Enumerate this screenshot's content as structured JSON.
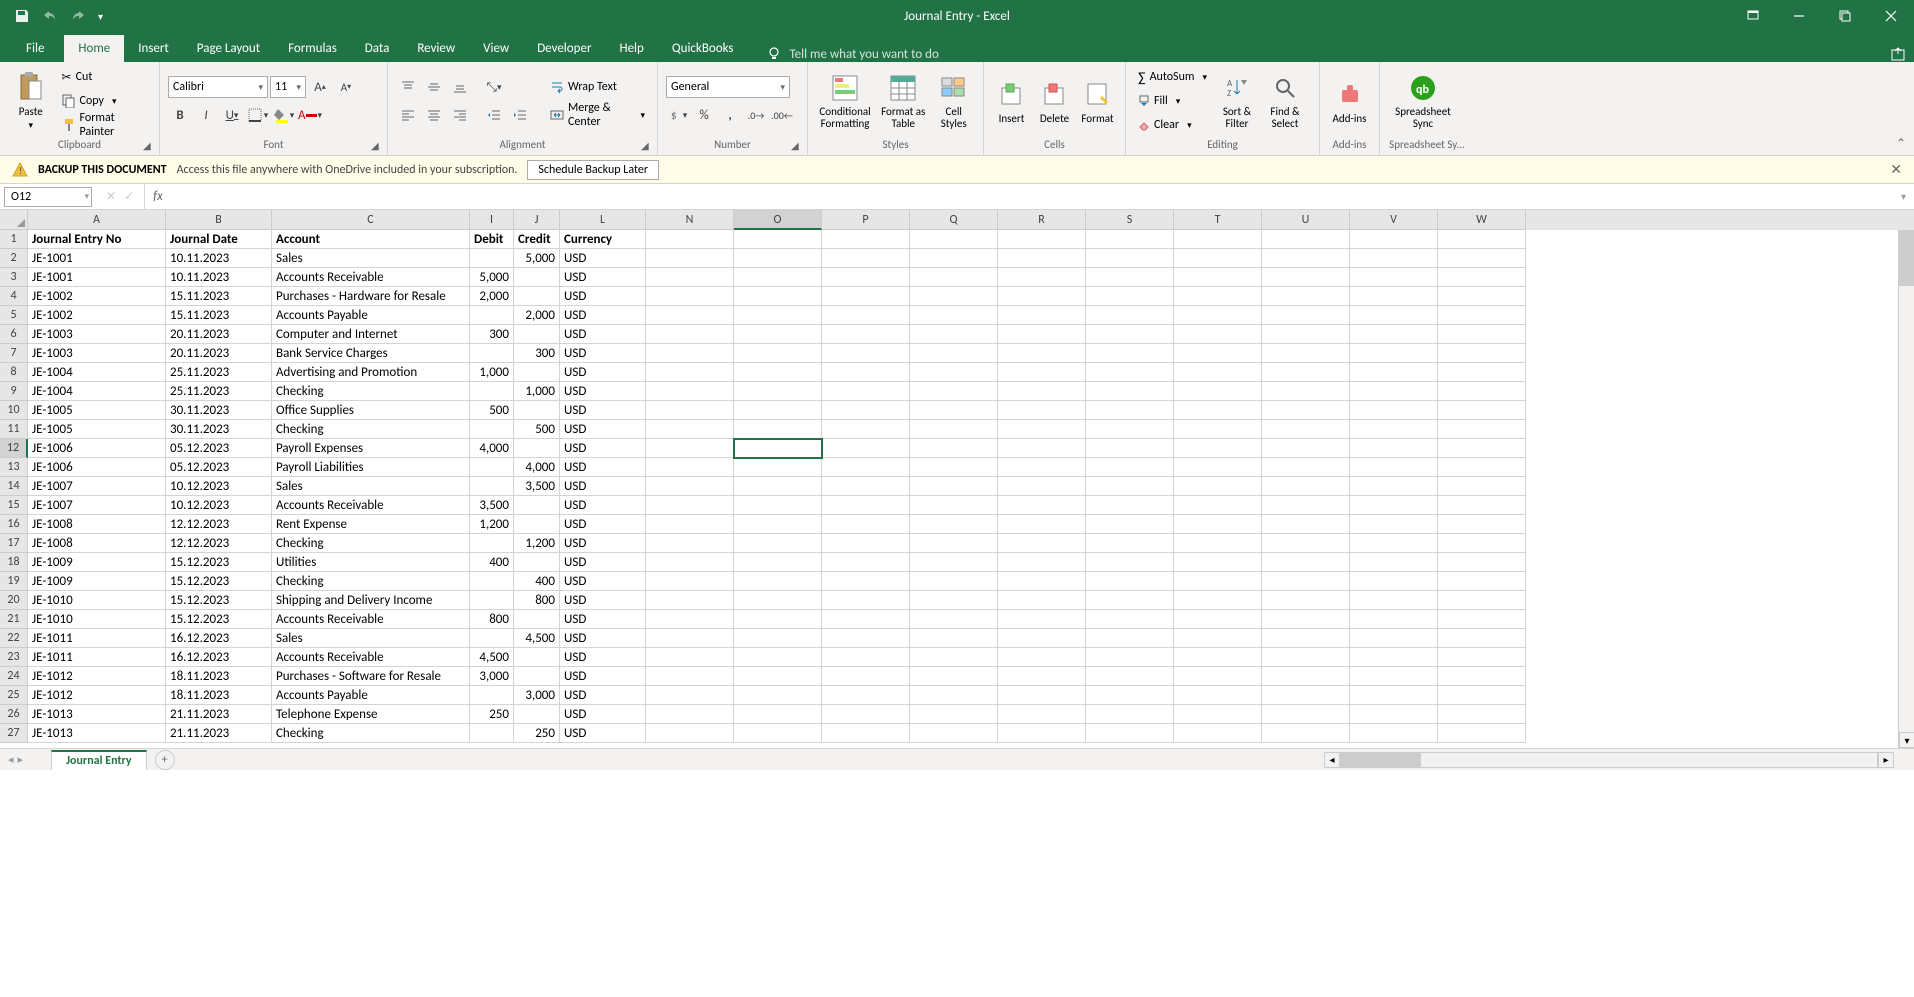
{
  "title": "Journal Entry  -  Excel",
  "ribbon_tabs": [
    "File",
    "Home",
    "Insert",
    "Page Layout",
    "Formulas",
    "Data",
    "Review",
    "View",
    "Developer",
    "Help",
    "QuickBooks"
  ],
  "active_tab": "Home",
  "tell_me": "Tell me what you want to do",
  "clipboard": {
    "paste": "Paste",
    "cut": "Cut",
    "copy": "Copy",
    "format_painter": "Format Painter",
    "label": "Clipboard"
  },
  "font": {
    "name": "Calibri",
    "size": "11",
    "label": "Font"
  },
  "alignment": {
    "wrap": "Wrap Text",
    "merge": "Merge & Center",
    "label": "Alignment"
  },
  "number": {
    "format": "General",
    "label": "Number"
  },
  "styles": {
    "conditional": "Conditional Formatting",
    "table": "Format as Table",
    "cell": "Cell Styles",
    "label": "Styles"
  },
  "cells": {
    "insert": "Insert",
    "delete": "Delete",
    "format": "Format",
    "label": "Cells"
  },
  "editing": {
    "autosum": "AutoSum",
    "fill": "Fill",
    "clear": "Clear",
    "sort": "Sort & Filter",
    "find": "Find & Select",
    "label": "Editing"
  },
  "addins": {
    "btn": "Add-ins",
    "label": "Add-ins"
  },
  "qb": {
    "sync": "Spreadsheet Sync",
    "label": "Spreadsheet Sy..."
  },
  "message_bar": {
    "strong": "BACKUP THIS DOCUMENT",
    "text": "Access this file anywhere with OneDrive included in your subscription.",
    "btn": "Schedule Backup Later"
  },
  "name_box": "O12",
  "formula_value": "",
  "sheet_tab": "Journal Entry",
  "columns": [
    "A",
    "B",
    "C",
    "I",
    "J",
    "L",
    "N",
    "O",
    "P",
    "Q",
    "R",
    "S",
    "T",
    "U",
    "V",
    "W"
  ],
  "col_widths": {
    "A": 138,
    "B": 106,
    "C": 198,
    "I": 44,
    "J": 46,
    "L": 86,
    "N": 88,
    "O": 88,
    "P": 88,
    "Q": 88,
    "R": 88,
    "S": 88,
    "T": 88,
    "U": 88,
    "V": 88,
    "W": 88
  },
  "selected_cell": {
    "row": 12,
    "col": "O"
  },
  "headers": {
    "A": "Journal Entry No",
    "B": "Journal Date",
    "C": "Account",
    "I": "Debit",
    "J": "Credit",
    "L": "Currency"
  },
  "rows": [
    {
      "n": 2,
      "A": "JE-1001",
      "B": "10.11.2023",
      "C": "Sales",
      "I": "",
      "J": "5,000",
      "L": "USD"
    },
    {
      "n": 3,
      "A": "JE-1001",
      "B": "10.11.2023",
      "C": "Accounts Receivable",
      "I": "5,000",
      "J": "",
      "L": "USD"
    },
    {
      "n": 4,
      "A": "JE-1002",
      "B": "15.11.2023",
      "C": "Purchases - Hardware for Resale",
      "I": "2,000",
      "J": "",
      "L": "USD"
    },
    {
      "n": 5,
      "A": "JE-1002",
      "B": "15.11.2023",
      "C": "Accounts Payable",
      "I": "",
      "J": "2,000",
      "L": "USD"
    },
    {
      "n": 6,
      "A": "JE-1003",
      "B": "20.11.2023",
      "C": "Computer and Internet",
      "I": "300",
      "J": "",
      "L": "USD"
    },
    {
      "n": 7,
      "A": "JE-1003",
      "B": "20.11.2023",
      "C": "Bank Service Charges",
      "I": "",
      "J": "300",
      "L": "USD"
    },
    {
      "n": 8,
      "A": "JE-1004",
      "B": "25.11.2023",
      "C": "Advertising and Promotion",
      "I": "1,000",
      "J": "",
      "L": "USD"
    },
    {
      "n": 9,
      "A": "JE-1004",
      "B": "25.11.2023",
      "C": "Checking",
      "I": "",
      "J": "1,000",
      "L": "USD"
    },
    {
      "n": 10,
      "A": "JE-1005",
      "B": "30.11.2023",
      "C": "Office Supplies",
      "I": "500",
      "J": "",
      "L": "USD"
    },
    {
      "n": 11,
      "A": "JE-1005",
      "B": "30.11.2023",
      "C": "Checking",
      "I": "",
      "J": "500",
      "L": "USD"
    },
    {
      "n": 12,
      "A": "JE-1006",
      "B": "05.12.2023",
      "C": "Payroll Expenses",
      "I": "4,000",
      "J": "",
      "L": "USD"
    },
    {
      "n": 13,
      "A": "JE-1006",
      "B": "05.12.2023",
      "C": "Payroll Liabilities",
      "I": "",
      "J": "4,000",
      "L": "USD"
    },
    {
      "n": 14,
      "A": "JE-1007",
      "B": "10.12.2023",
      "C": "Sales",
      "I": "",
      "J": "3,500",
      "L": "USD"
    },
    {
      "n": 15,
      "A": "JE-1007",
      "B": "10.12.2023",
      "C": "Accounts Receivable",
      "I": "3,500",
      "J": "",
      "L": "USD"
    },
    {
      "n": 16,
      "A": "JE-1008",
      "B": "12.12.2023",
      "C": "Rent Expense",
      "I": "1,200",
      "J": "",
      "L": "USD"
    },
    {
      "n": 17,
      "A": "JE-1008",
      "B": "12.12.2023",
      "C": "Checking",
      "I": "",
      "J": "1,200",
      "L": "USD"
    },
    {
      "n": 18,
      "A": "JE-1009",
      "B": "15.12.2023",
      "C": "Utilities",
      "I": "400",
      "J": "",
      "L": "USD"
    },
    {
      "n": 19,
      "A": "JE-1009",
      "B": "15.12.2023",
      "C": "Checking",
      "I": "",
      "J": "400",
      "L": "USD"
    },
    {
      "n": 20,
      "A": "JE-1010",
      "B": "15.12.2023",
      "C": "Shipping and Delivery Income",
      "I": "",
      "J": "800",
      "L": "USD"
    },
    {
      "n": 21,
      "A": "JE-1010",
      "B": "15.12.2023",
      "C": "Accounts Receivable",
      "I": "800",
      "J": "",
      "L": "USD"
    },
    {
      "n": 22,
      "A": "JE-1011",
      "B": "16.12.2023",
      "C": "Sales",
      "I": "",
      "J": "4,500",
      "L": "USD"
    },
    {
      "n": 23,
      "A": "JE-1011",
      "B": "16.12.2023",
      "C": "Accounts Receivable",
      "I": "4,500",
      "J": "",
      "L": "USD"
    },
    {
      "n": 24,
      "A": "JE-1012",
      "B": "18.11.2023",
      "C": "Purchases - Software for Resale",
      "I": "3,000",
      "J": "",
      "L": "USD"
    },
    {
      "n": 25,
      "A": "JE-1012",
      "B": "18.11.2023",
      "C": "Accounts Payable",
      "I": "",
      "J": "3,000",
      "L": "USD"
    },
    {
      "n": 26,
      "A": "JE-1013",
      "B": "21.11.2023",
      "C": "Telephone Expense",
      "I": "250",
      "J": "",
      "L": "USD"
    },
    {
      "n": 27,
      "A": "JE-1013",
      "B": "21.11.2023",
      "C": "Checking",
      "I": "",
      "J": "250",
      "L": "USD"
    }
  ]
}
